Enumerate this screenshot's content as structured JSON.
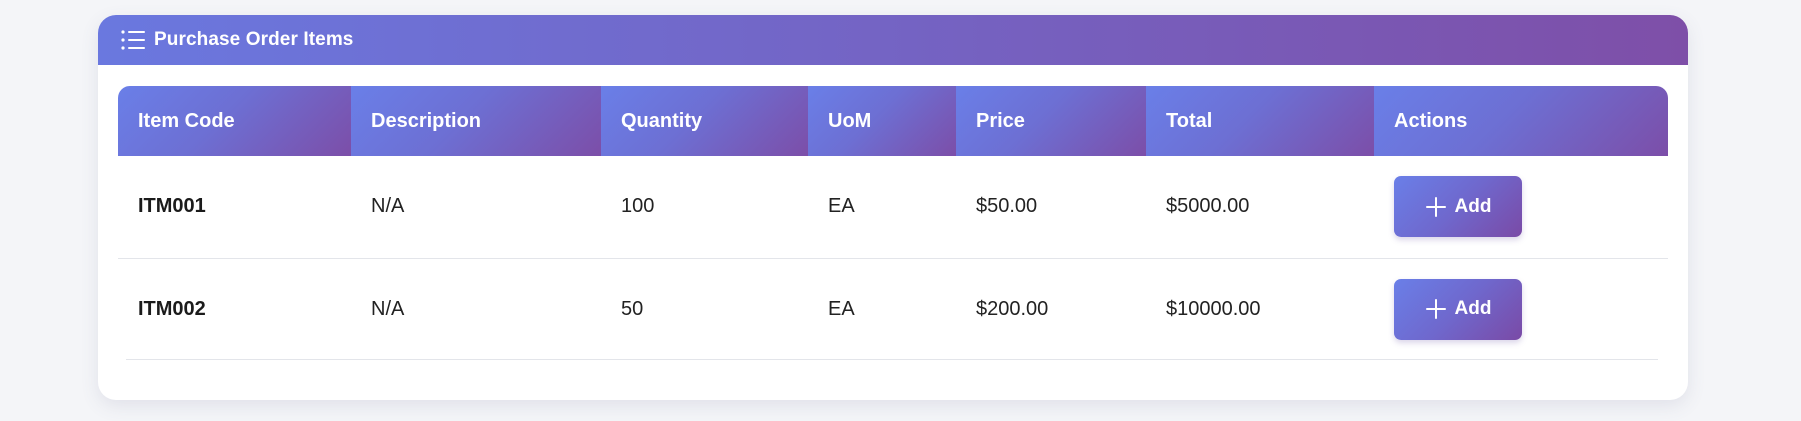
{
  "card": {
    "title": "Purchase Order Items",
    "icon": "list-icon"
  },
  "colors": {
    "gradient_start": "#6a7fe8",
    "gradient_end": "#7c4ea8",
    "background": "#f4f5f8"
  },
  "table": {
    "columns": [
      "Item Code",
      "Description",
      "Quantity",
      "UoM",
      "Price",
      "Total",
      "Actions"
    ],
    "rows": [
      {
        "item_code": "ITM001",
        "description": "N/A",
        "quantity": "100",
        "uom": "EA",
        "price": "$50.00",
        "total": "$5000.00",
        "action_label": "Add"
      },
      {
        "item_code": "ITM002",
        "description": "N/A",
        "quantity": "50",
        "uom": "EA",
        "price": "$200.00",
        "total": "$10000.00",
        "action_label": "Add"
      }
    ]
  }
}
